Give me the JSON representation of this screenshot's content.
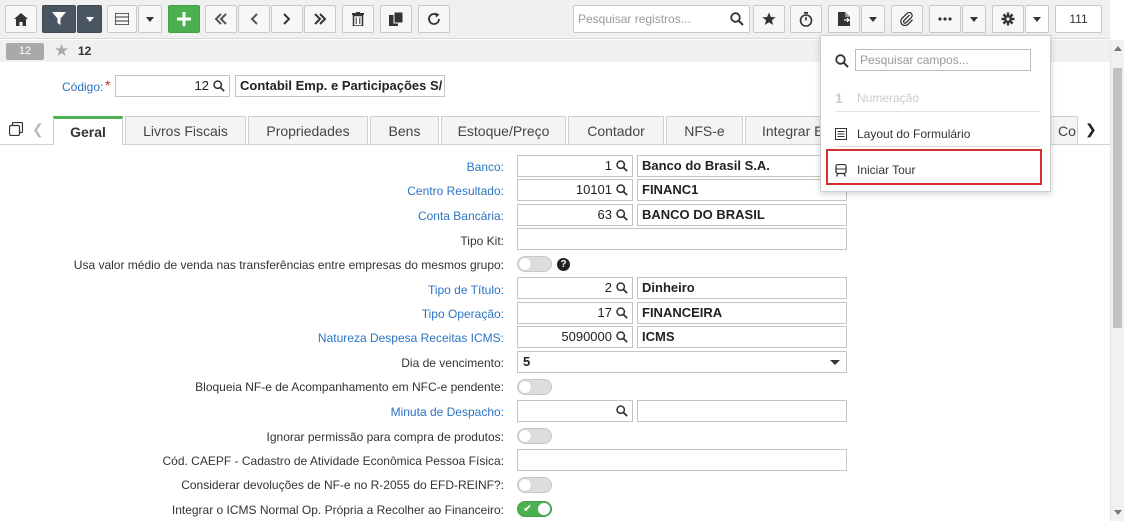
{
  "toolbar": {
    "search_placeholder": "Pesquisar registros...",
    "record_count": "111",
    "icons": [
      "home-icon",
      "filter-icon",
      "list-icon",
      "plus-icon",
      "first-icon",
      "prev-icon",
      "next-icon",
      "last-icon",
      "trash-icon",
      "copy-icon",
      "refresh-icon",
      "search-icon",
      "star-icon",
      "timer-icon",
      "document-icon",
      "paperclip-icon",
      "more-icon",
      "gear-icon"
    ]
  },
  "record": {
    "badge": "12",
    "number": "12"
  },
  "codigo": {
    "label": "Código:",
    "value": "12",
    "description": "Contabil Emp. e Participações S/"
  },
  "tabs": [
    "Geral",
    "Livros Fiscais",
    "Propriedades",
    "Bens",
    "Estoque/Preço",
    "Contador",
    "NFS-e",
    "Integrar E",
    "Co"
  ],
  "form": {
    "banco": {
      "label": "Banco:",
      "code": "1",
      "name": "Banco do Brasil S.A."
    },
    "centro": {
      "label": "Centro Resultado:",
      "code": "10101",
      "name": "FINANC1"
    },
    "conta": {
      "label": "Conta Bancária:",
      "code": "63",
      "name": "BANCO DO BRASIL"
    },
    "tipo_kit": {
      "label": "Tipo Kit:"
    },
    "valor_medio": {
      "label": "Usa valor médio de venda nas transferências entre empresas do mesmos grupo:"
    },
    "tipo_titulo": {
      "label": "Tipo de Título:",
      "code": "2",
      "name": "Dinheiro"
    },
    "tipo_operacao": {
      "label": "Tipo Operação:",
      "code": "17",
      "name": "FINANCEIRA"
    },
    "natureza": {
      "label": "Natureza Despesa Receitas ICMS:",
      "code": "5090000",
      "name": "ICMS"
    },
    "dia_venc": {
      "label": "Dia de vencimento:",
      "value": "5"
    },
    "bloqueia": {
      "label": "Bloqueia NF-e de Acompanhamento em NFC-e pendente:"
    },
    "minuta": {
      "label": "Minuta de Despacho:"
    },
    "ignorar": {
      "label": "Ignorar permissão para compra de produtos:"
    },
    "caepf": {
      "label": "Cód. CAEPF - Cadastro de Atividade Econômica Pessoa Física:"
    },
    "devolucoes": {
      "label": "Considerar devoluções de NF-e no R-2055 do EFD-REINF?:"
    },
    "integrar_icms": {
      "label": "Integrar o ICMS Normal Op. Própria a Recolher ao Financeiro:"
    }
  },
  "dropdown": {
    "search_placeholder": "Pesquisar campos...",
    "numeracao": "Numeração",
    "layout": "Layout do Formulário",
    "tour": "Iniciar Tour"
  },
  "colors": {
    "accent": "#4caf50",
    "link": "#2b74c4",
    "dark_button": "#4a5564",
    "highlight": "#d32f2f"
  }
}
